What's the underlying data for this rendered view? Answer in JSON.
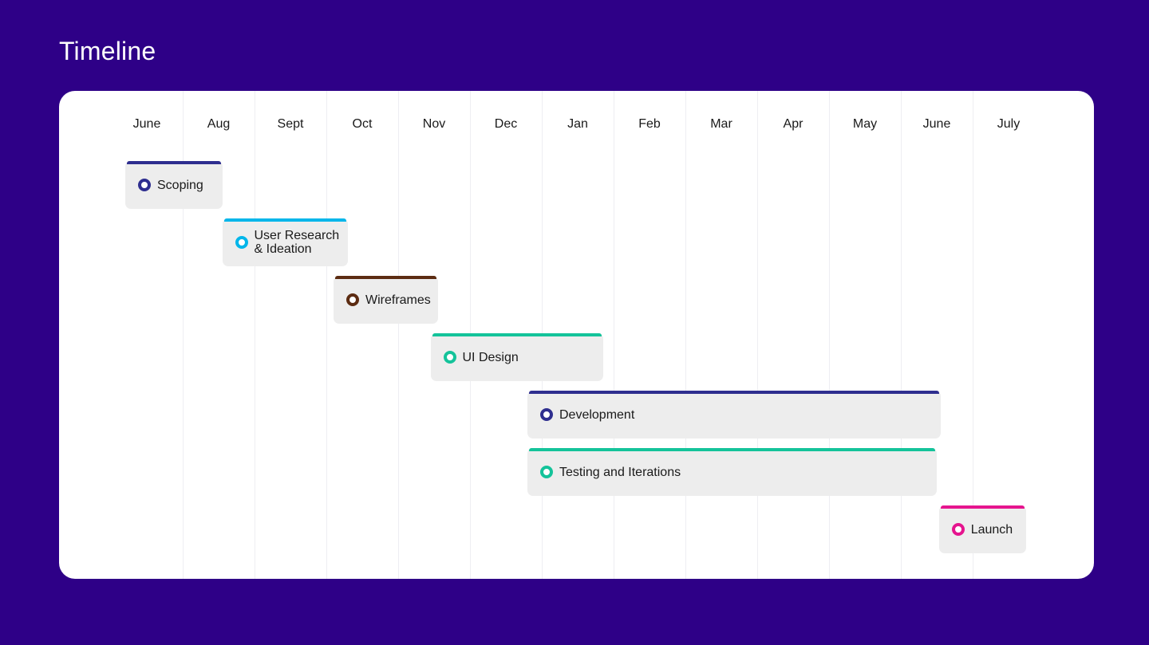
{
  "page": {
    "title": "Timeline"
  },
  "chart_data": {
    "type": "gantt",
    "x_axis": {
      "tick_labels": [
        "June",
        "Aug",
        "Sept",
        "Oct",
        "Nov",
        "Dec",
        "Jan",
        "Feb",
        "Mar",
        "Apr",
        "May",
        "June",
        "July"
      ]
    },
    "tasks": [
      {
        "label": "Scoping",
        "start": -0.3,
        "end": 1.05,
        "color": "#2e2e8f"
      },
      {
        "label": "User Research\n& Ideation",
        "start": 1.05,
        "end": 2.8,
        "color": "#00b6ea"
      },
      {
        "label": "Wireframes",
        "start": 2.6,
        "end": 4.05,
        "color": "#5c2c12"
      },
      {
        "label": "UI Design",
        "start": 3.95,
        "end": 6.35,
        "color": "#14c39a"
      },
      {
        "label": "Development",
        "start": 5.3,
        "end": 11.05,
        "color": "#2e2e8f"
      },
      {
        "label": "Testing and Iterations",
        "start": 5.3,
        "end": 11.0,
        "color": "#14c39a"
      },
      {
        "label": "Launch",
        "start": 11.03,
        "end": 12.25,
        "color": "#e5148e"
      }
    ]
  }
}
